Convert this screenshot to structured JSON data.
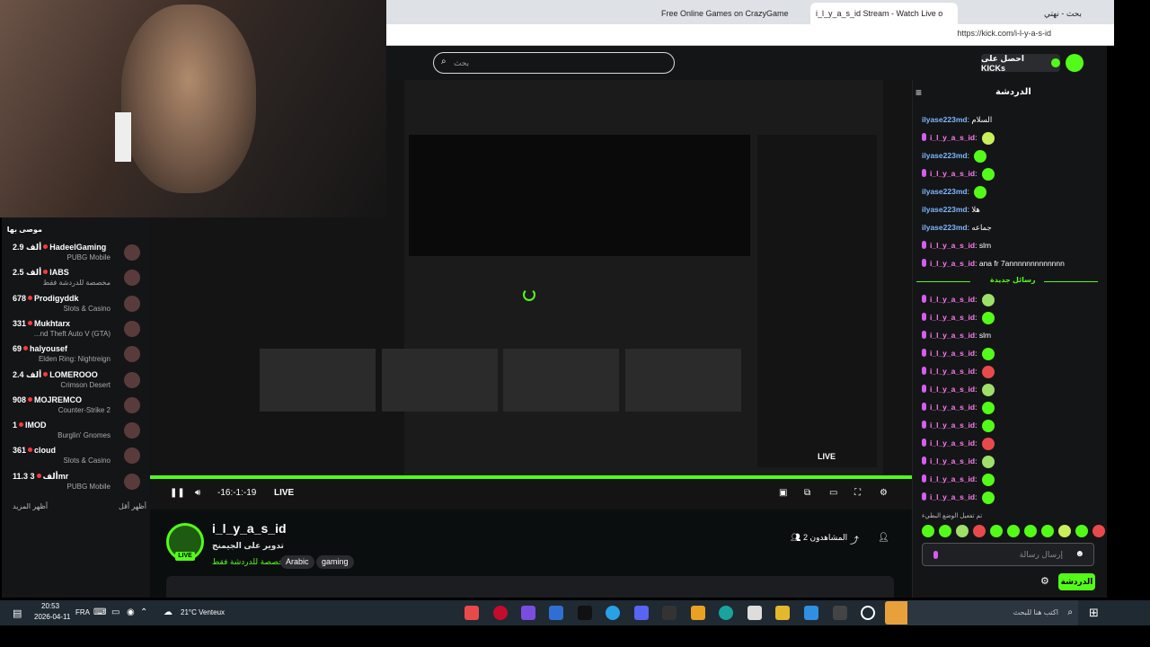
{
  "browser": {
    "tabs": [
      {
        "label": "Free Online Games on CrazyGame",
        "active": false
      },
      {
        "label": "i_l_y_a_s_id Stream - Watch Live o",
        "active": true
      },
      {
        "label": "بحث - نهتي",
        "active": false
      }
    ],
    "url": "https://kick.com/i-l-y-a-s-id"
  },
  "header": {
    "search_placeholder": "بحث",
    "get_kicks": "احصل على KICKs"
  },
  "sidebar": {
    "title": "موصى بها",
    "items": [
      {
        "count": "2.9 ألف",
        "name": "HadeelGaming",
        "category": "PUBG Mobile"
      },
      {
        "count": "2.5 ألف",
        "name": "IABS",
        "category": "مخصصة للدردشة فقط"
      },
      {
        "count": "678",
        "name": "Prodigyddk",
        "category": "Slots & Casino"
      },
      {
        "count": "331",
        "name": "Mukhtarx",
        "category": "...nd Theft Auto V (GTA)"
      },
      {
        "count": "69",
        "name": "halyousef",
        "category": "Elden Ring: Nightreign"
      },
      {
        "count": "2.4 ألف",
        "name": "LOMEROOO",
        "category": "Crimson Desert"
      },
      {
        "count": "908",
        "name": "MOJREMCO",
        "category": "Counter-Strike 2"
      },
      {
        "count": "1",
        "name": "IMOD",
        "category": "Burglin' Gnomes"
      },
      {
        "count": "361",
        "name": "cloud",
        "category": "Slots & Casino"
      },
      {
        "count": "11.3 ألف",
        "name": "3mr",
        "category": "PUBG Mobile"
      }
    ],
    "show_more": "أظهر المزيد",
    "show_less": "أظهر أقل"
  },
  "player": {
    "time": "-16:-1:-19",
    "live": "LIVE",
    "inner_live": "LIVE"
  },
  "channel": {
    "name": "i_l_y_a_s_id",
    "title": "تدوير على الجيمنج",
    "category": "مخصصة للدردشة فقط",
    "tags": [
      "Arabic",
      "gaming"
    ],
    "viewers": "2 المشاهدون",
    "live_badge": "LIVE"
  },
  "chat": {
    "title": "الدردشة",
    "messages": [
      {
        "user": "ilyase223md",
        "text": "السلام",
        "type": "u1",
        "emote": ""
      },
      {
        "user": "i_l_y_a_s_id",
        "text": "",
        "type": "u2",
        "emote": "#c8f05a"
      },
      {
        "user": "ilyase223md",
        "text": "",
        "type": "u1",
        "emote": "#53fc18"
      },
      {
        "user": "i_l_y_a_s_id",
        "text": "",
        "type": "u2",
        "emote": "#53fc18"
      },
      {
        "user": "ilyase223md",
        "text": "",
        "type": "u1",
        "emote": "#53fc18"
      },
      {
        "user": "ilyase223md",
        "text": "هلا",
        "type": "u1",
        "emote": ""
      },
      {
        "user": "ilyase223md",
        "text": "جماعه",
        "type": "u1",
        "emote": ""
      },
      {
        "user": "i_l_y_a_s_id",
        "text": "slm",
        "type": "u2",
        "emote": ""
      },
      {
        "user": "i_l_y_a_s_id",
        "text": "ana fr 7annnnnnnnnnnnn",
        "type": "u2",
        "emote": ""
      }
    ],
    "new_messages_label": "رسائل جديدة",
    "new_messages": [
      {
        "user": "i_l_y_a_s_id",
        "text": "",
        "emote": "#9ee06a"
      },
      {
        "user": "i_l_y_a_s_id",
        "text": "",
        "emote": "#53fc18"
      },
      {
        "user": "i_l_y_a_s_id",
        "text": "slm",
        "emote": ""
      },
      {
        "user": "i_l_y_a_s_id",
        "text": "",
        "emote": "#53fc18"
      },
      {
        "user": "i_l_y_a_s_id",
        "text": "",
        "emote": "#e84a4a"
      },
      {
        "user": "i_l_y_a_s_id",
        "text": "",
        "emote": "#9ee06a"
      },
      {
        "user": "i_l_y_a_s_id",
        "text": "",
        "emote": "#53fc18"
      },
      {
        "user": "i_l_y_a_s_id",
        "text": "",
        "emote": "#53fc18"
      },
      {
        "user": "i_l_y_a_s_id",
        "text": "",
        "emote": "#e84a4a"
      },
      {
        "user": "i_l_y_a_s_id",
        "text": "",
        "emote": "#9ee06a"
      },
      {
        "user": "i_l_y_a_s_id",
        "text": "",
        "emote": "#53fc18"
      },
      {
        "user": "i_l_y_a_s_id",
        "text": "",
        "emote": "#53fc18"
      }
    ],
    "pinned_note": "تم تفعيل الوضع البطيء",
    "input_placeholder": "إرسال رسالة",
    "send_label": "الدردشة",
    "emote_colors": [
      "#53fc18",
      "#53fc18",
      "#9ee06a",
      "#e84a4a",
      "#53fc18",
      "#53fc18",
      "#53fc18",
      "#53fc18",
      "#c8f05a",
      "#53fc18",
      "#e84a4a"
    ]
  },
  "taskbar": {
    "time": "20:53",
    "date": "2026-04-11",
    "lang": "FRA",
    "weather": "21°C  Venteux",
    "search_placeholder": "اكتب هنا للبحث"
  },
  "colors": {
    "accent": "#53fc18",
    "bg": "#0b0e0f",
    "panel": "#141517"
  }
}
